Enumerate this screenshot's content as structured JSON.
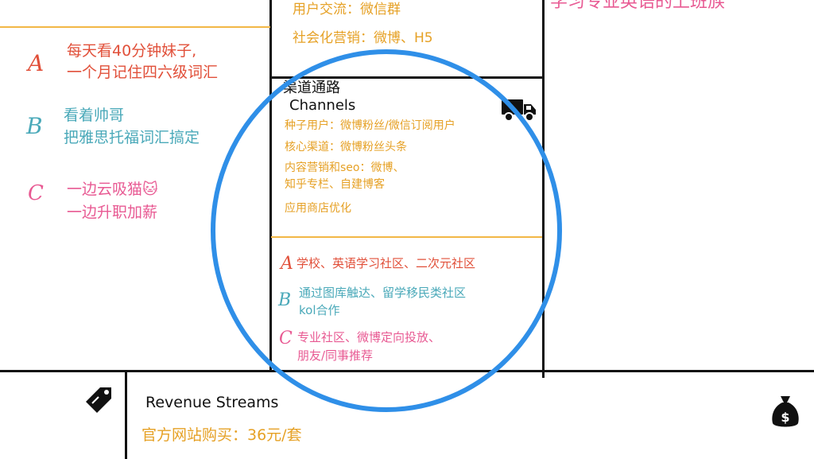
{
  "top_middle": {
    "line1": "用户交流：微信群",
    "line2": "社会化营销：微博、H5"
  },
  "top_right": {
    "fragment": "学习专业英语的上班族"
  },
  "left": {
    "a_marker": "A",
    "a_line1": "每天看40分钟妹子,",
    "a_line2": "一个月记住四六级词汇",
    "b_marker": "B",
    "b_line1": "看着帅哥",
    "b_line2": "把雅思托福词汇搞定",
    "c_marker": "C",
    "c_line1": "一边云吸猫🐱",
    "c_line2": "一边升职加薪"
  },
  "channels": {
    "title_cn": "渠道通路",
    "title_en": "Channels",
    "icon": "truck-icon",
    "items": [
      "种子用户：微博粉丝/微信订阅用户",
      "核心渠道：微博粉丝头条",
      "内容营销和seo：微博、",
      "知乎专栏、自建博客",
      "应用商店优化"
    ],
    "a_marker": "A",
    "a_text": "学校、英语学习社区、二次元社区",
    "b_marker": "B",
    "b_line1": "通过图库触达、留学移民类社区",
    "b_line2": "kol合作",
    "c_marker": "C",
    "c_line1": "专业社区、微博定向投放、",
    "c_line2": "朋友/同事推荐"
  },
  "revenue": {
    "title": "Revenue Streams",
    "price": "官方网站购买：36元/套",
    "tag_icon": "price-tag-icon",
    "money_icon": "money-bag-icon"
  },
  "colors": {
    "highlight_circle": "#2f8fe8",
    "orange": "#e6a126",
    "red": "#e1503a",
    "teal": "#4aa9b9",
    "pink": "#e85a93"
  }
}
